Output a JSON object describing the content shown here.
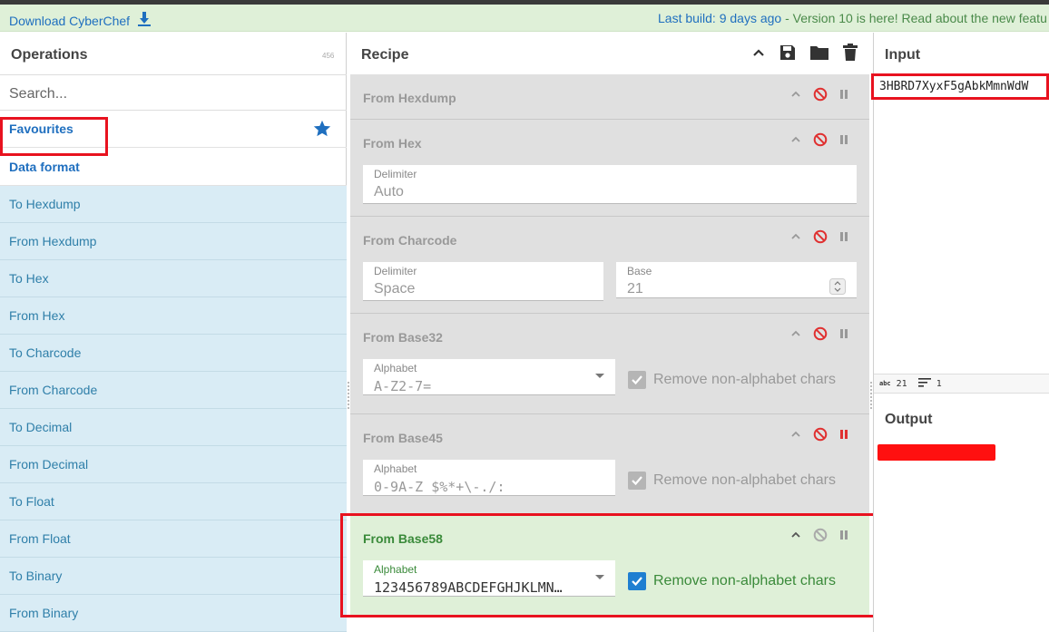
{
  "banner": {
    "download_label": "Download CyberChef",
    "last_build": "Last build: 9 days ago",
    "version_notice": " - Version 10 is here! Read about the new featu"
  },
  "operations": {
    "title": "Operations",
    "count": "456",
    "search_placeholder": "Search...",
    "favourites_label": "Favourites",
    "category_label": "Data format",
    "items": [
      "To Hexdump",
      "From Hexdump",
      "To Hex",
      "From Hex",
      "To Charcode",
      "From Charcode",
      "To Decimal",
      "From Decimal",
      "To Float",
      "From Float",
      "To Binary",
      "From Binary"
    ]
  },
  "recipe": {
    "title": "Recipe",
    "ingredients": [
      {
        "name": "From Hexdump"
      },
      {
        "name": "From Hex",
        "delimiter_label": "Delimiter",
        "delimiter_value": "Auto"
      },
      {
        "name": "From Charcode",
        "delimiter_label": "Delimiter",
        "delimiter_value": "Space",
        "base_label": "Base",
        "base_value": "21"
      },
      {
        "name": "From Base32",
        "alphabet_label": "Alphabet",
        "alphabet_value": "A-Z2-7=",
        "remove_label": "Remove non-alphabet chars"
      },
      {
        "name": "From Base45",
        "alphabet_label": "Alphabet",
        "alphabet_value": "0-9A-Z $%*+\\-./:",
        "remove_label": "Remove non-alphabet chars"
      },
      {
        "name": "From Base58",
        "alphabet_label": "Alphabet",
        "alphabet_value": "123456789ABCDEFGHJKLMN…",
        "remove_label": "Remove non-alphabet chars"
      }
    ]
  },
  "io": {
    "input_title": "Input",
    "input_value": "3HBRD7XyxF5gAbkMmnWdW",
    "stats_abc_icon": "abc",
    "stats_length": "21",
    "stats_lines": "1",
    "output_title": "Output"
  },
  "colors": {
    "accent_blue": "#1f6fbf",
    "active_green": "#dff0d8",
    "highlight_red": "#e8121f",
    "disable_red": "#e03030"
  }
}
